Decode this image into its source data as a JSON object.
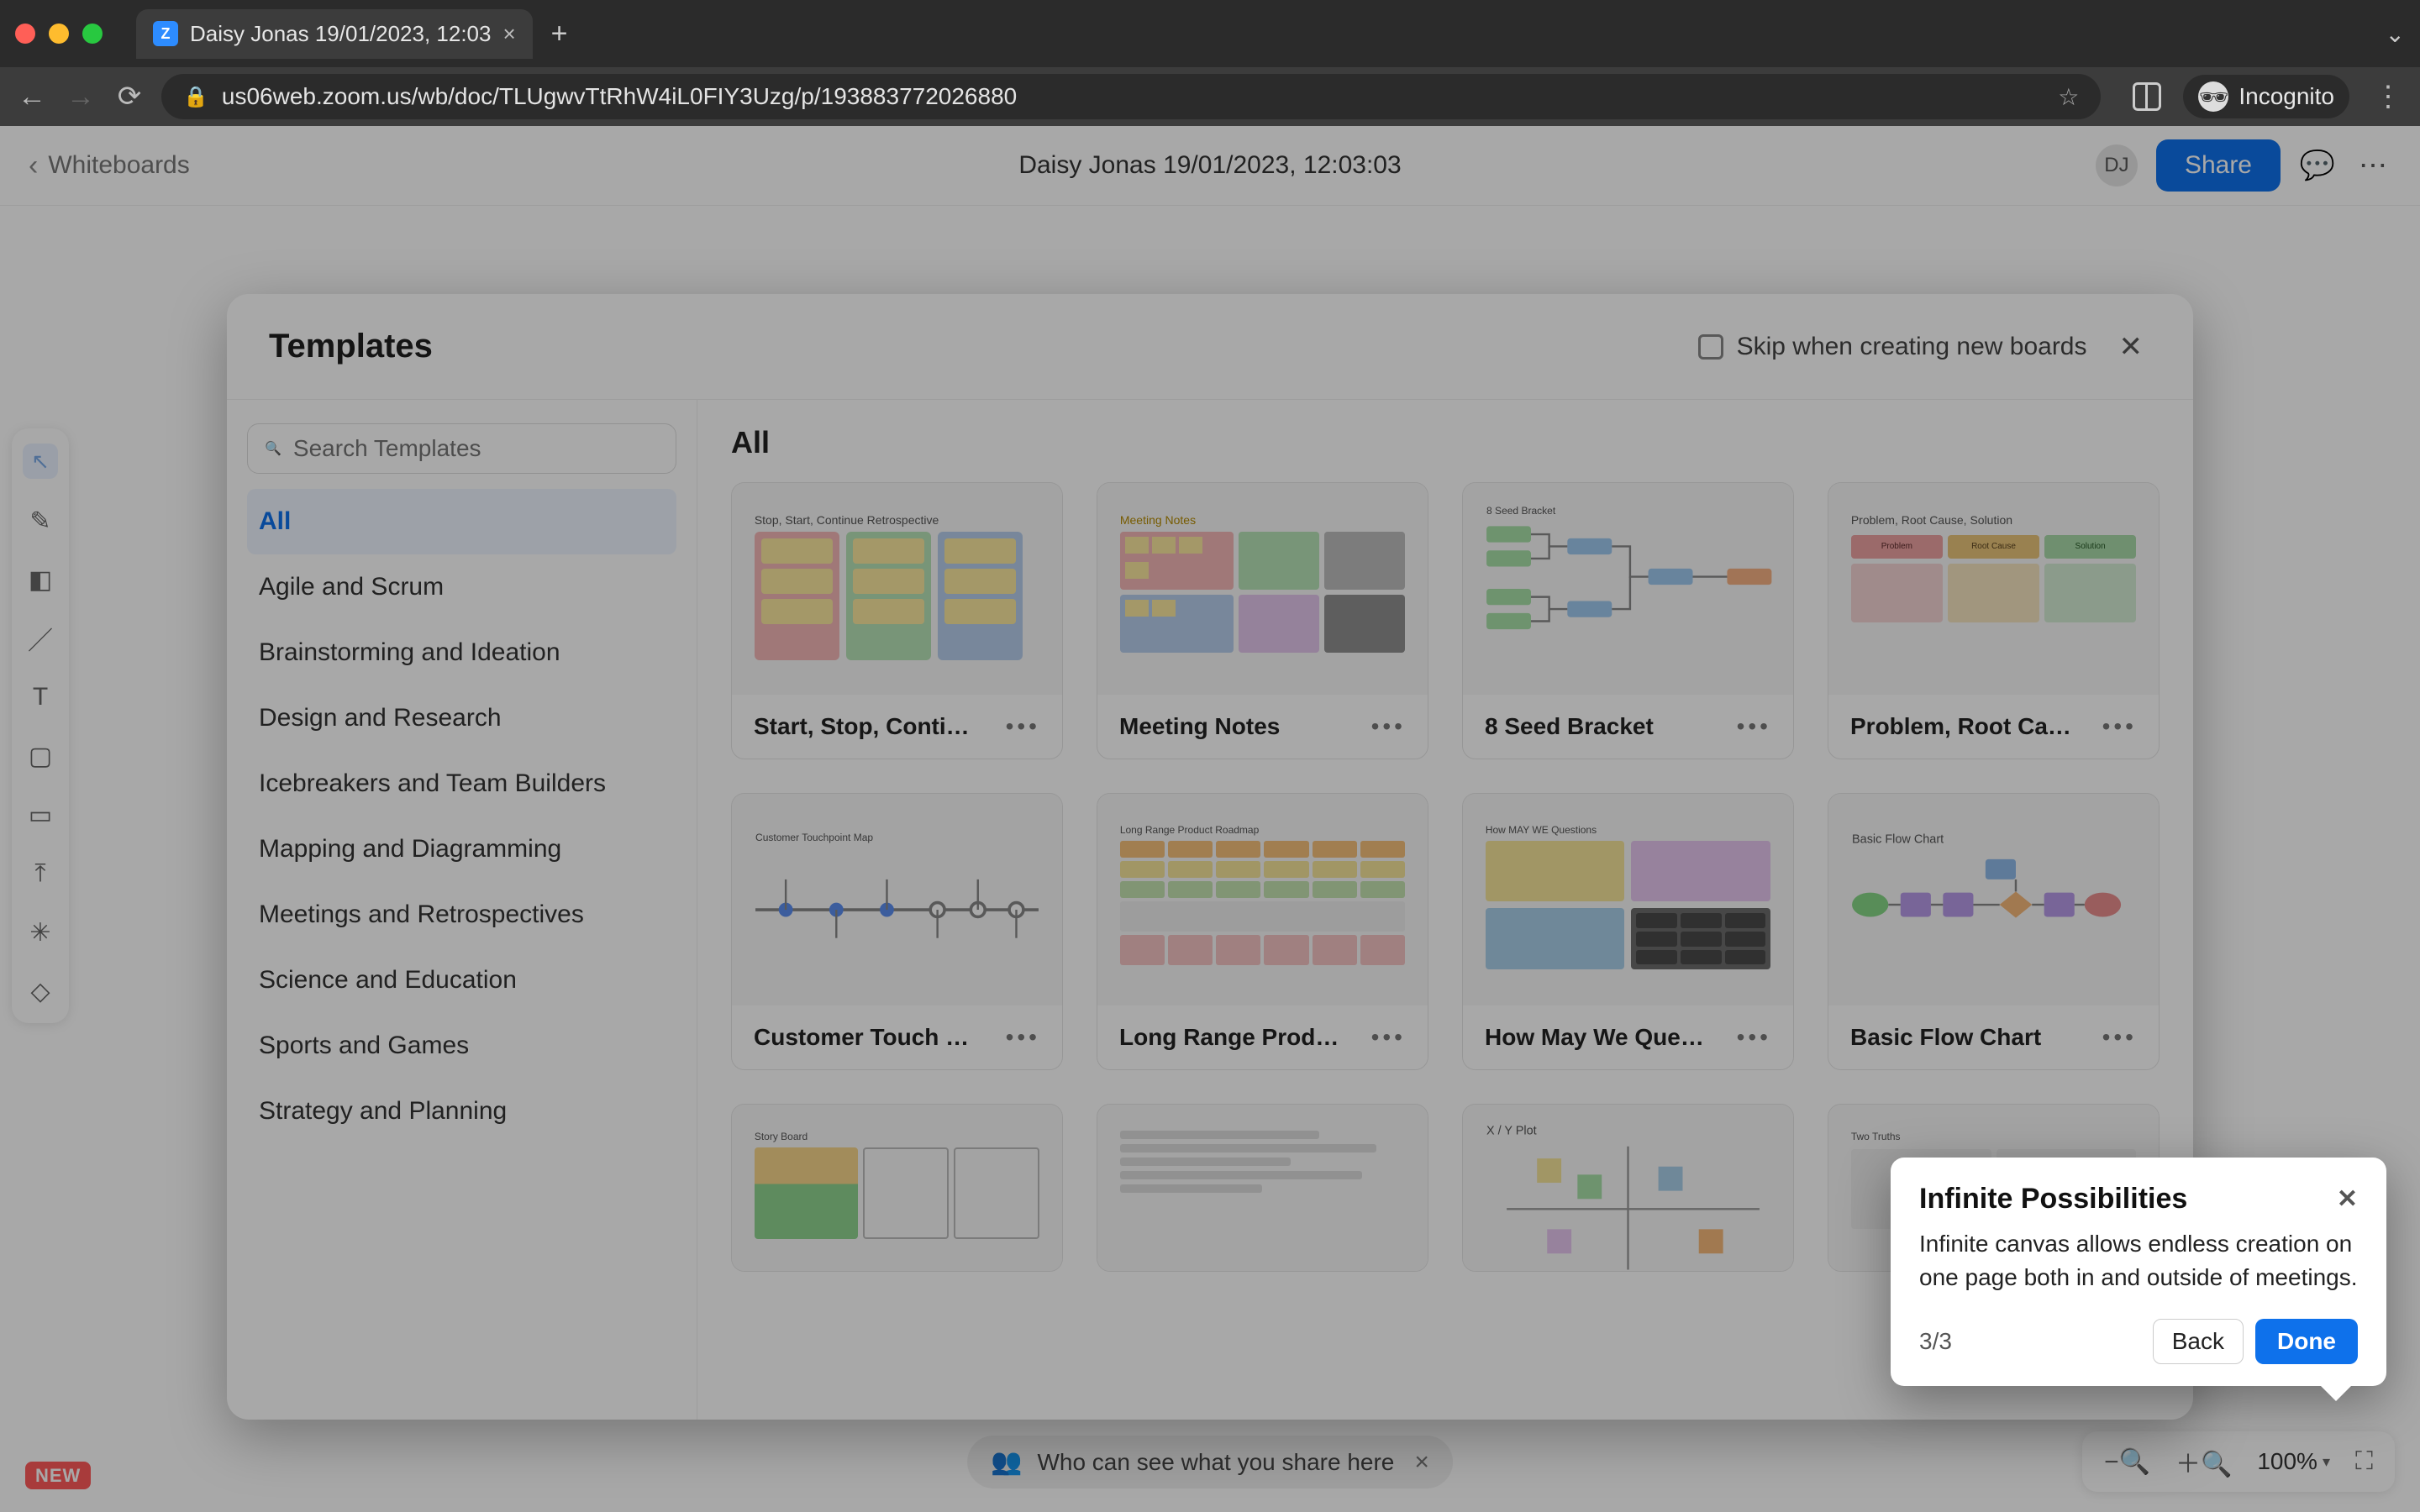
{
  "browser": {
    "tab_title": "Daisy Jonas 19/01/2023, 12:03",
    "url": "us06web.zoom.us/wb/doc/TLUgwvTtRhW4iL0FIY3Uzg/p/193883772026880",
    "incognito_label": "Incognito"
  },
  "app": {
    "back_label": "Whiteboards",
    "doc_title": "Daisy Jonas 19/01/2023, 12:03:03",
    "user_initials": "DJ",
    "share_label": "Share",
    "new_badge": "NEW",
    "share_pill": "Who can see what you share here",
    "zoom_value": "100%"
  },
  "modal": {
    "title": "Templates",
    "skip_label": "Skip when creating new boards",
    "search_placeholder": "Search Templates",
    "gallery_heading": "All",
    "categories": [
      "All",
      "Agile and Scrum",
      "Brainstorming and Ideation",
      "Design and Research",
      "Icebreakers and Team Builders",
      "Mapping and Diagramming",
      "Meetings and Retrospectives",
      "Science and Education",
      "Sports and Games",
      "Strategy and Planning"
    ],
    "templates": [
      {
        "name": "Start, Stop, Conti…"
      },
      {
        "name": "Meeting Notes"
      },
      {
        "name": "8 Seed Bracket"
      },
      {
        "name": "Problem, Root Ca…"
      },
      {
        "name": "Customer Touch …"
      },
      {
        "name": "Long Range Prod…"
      },
      {
        "name": "How May We Que…"
      },
      {
        "name": "Basic Flow Chart"
      }
    ]
  },
  "popover": {
    "title": "Infinite Possibilities",
    "body": "Infinite canvas allows endless creation on one page both in and outside of meetings.",
    "step": "3/3",
    "back_label": "Back",
    "done_label": "Done"
  },
  "colors": {
    "accent": "#0e71eb"
  }
}
